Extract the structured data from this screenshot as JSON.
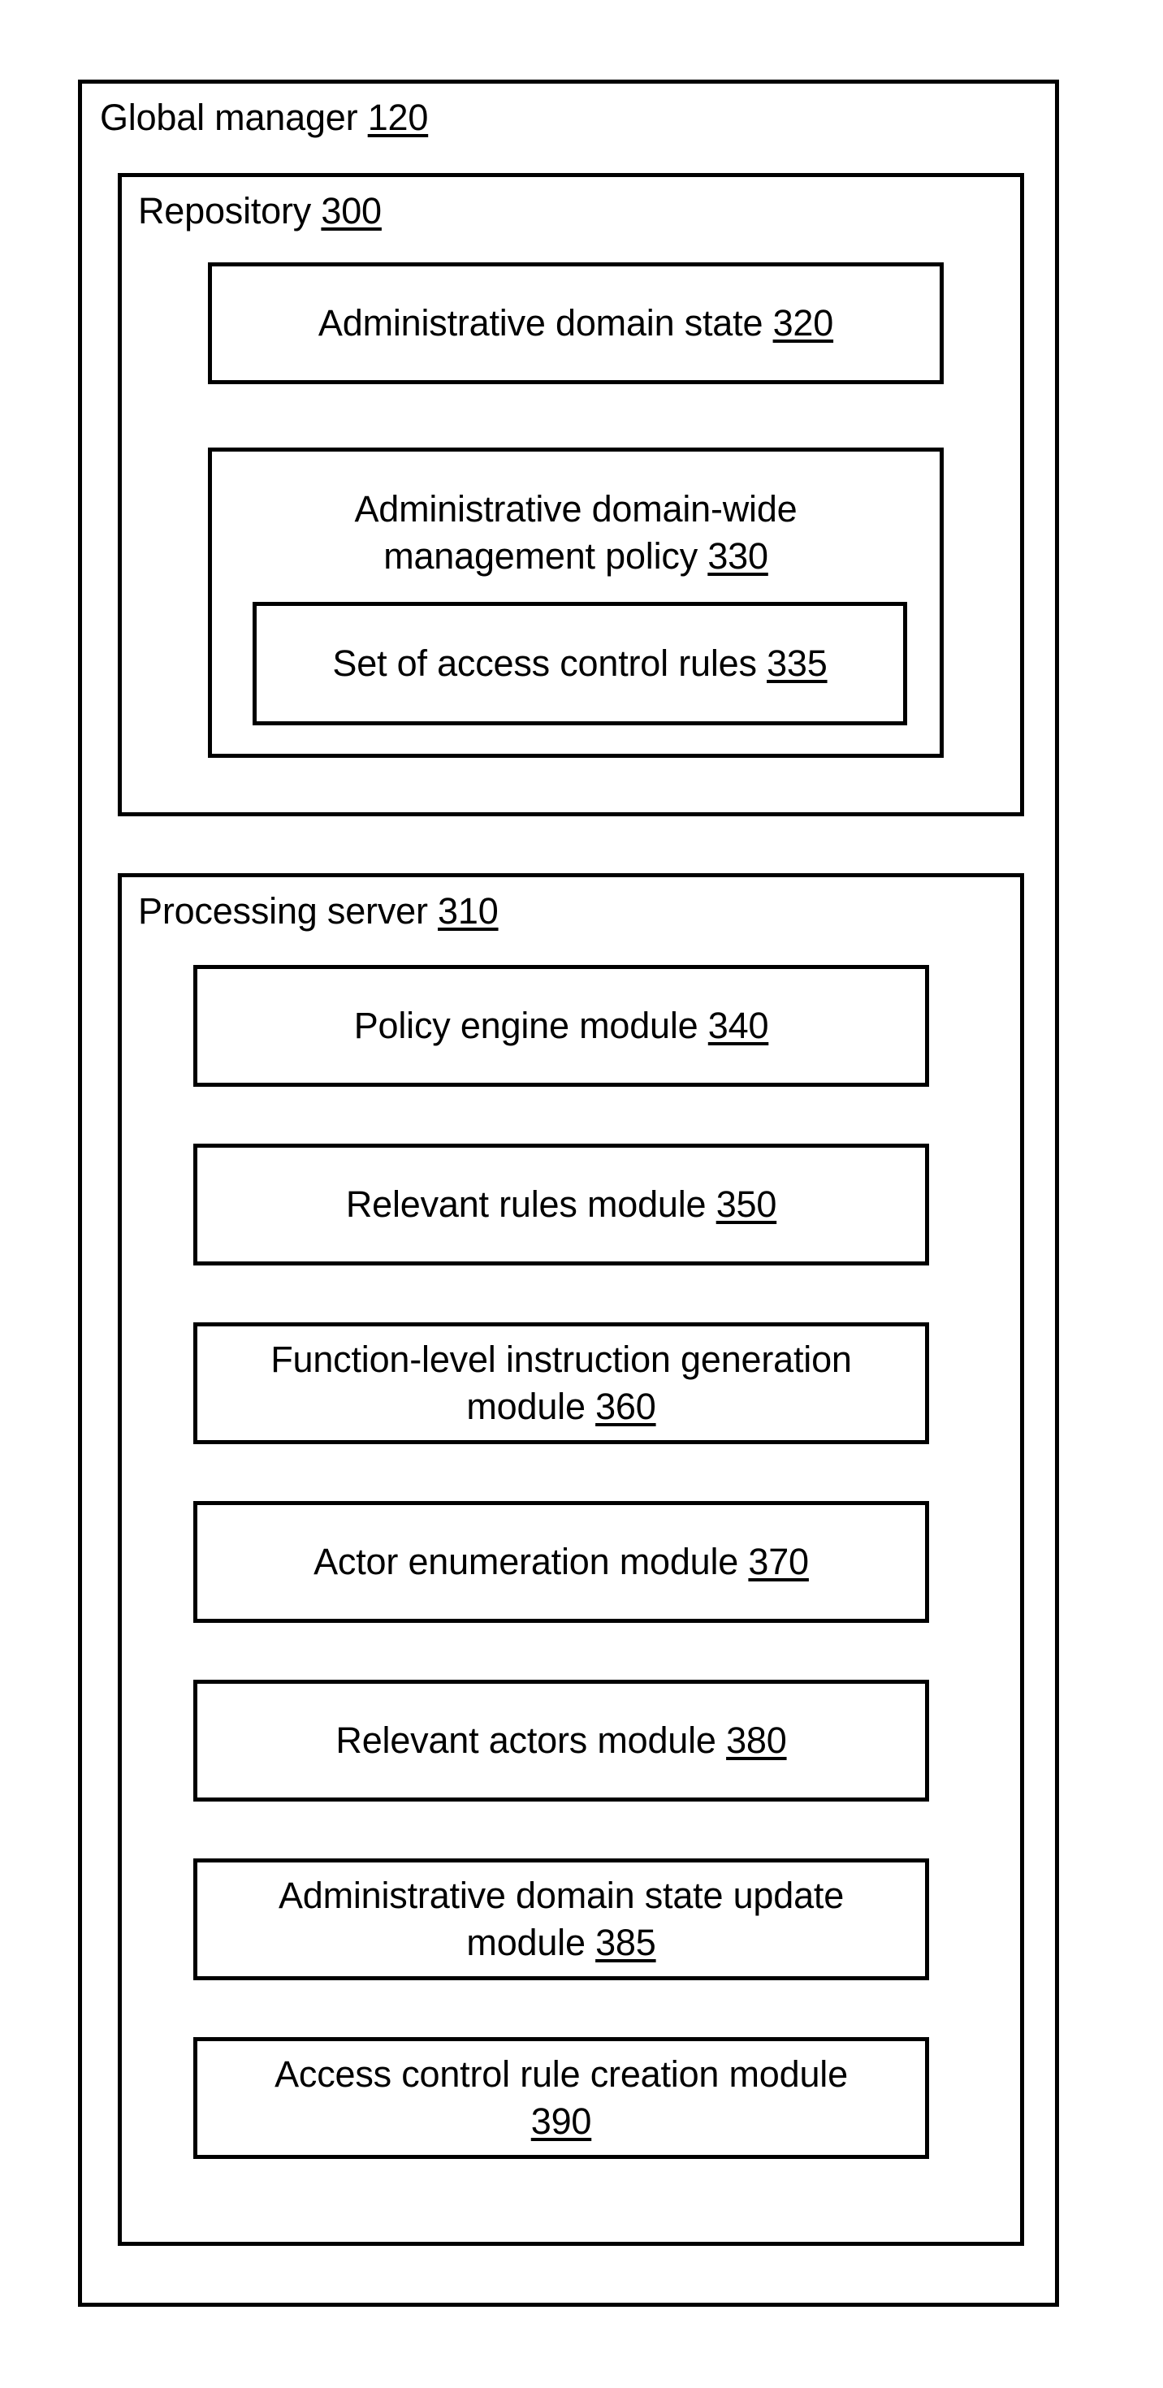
{
  "figure": {
    "type": "block-diagram",
    "title": "Global manager block diagram"
  },
  "global_manager": {
    "label": "Global manager",
    "ref": "120"
  },
  "repository": {
    "label": "Repository",
    "ref": "300",
    "boxes": [
      {
        "name": "administrative-domain-state",
        "label": "Administrative domain state",
        "ref": "320"
      },
      {
        "name": "administrative-domain-wide-management-policy",
        "label": "Administrative domain-wide management policy",
        "line1": "Administrative domain-wide",
        "line2": "management policy",
        "ref": "330",
        "children": [
          {
            "name": "set-of-access-control-rules",
            "label": "Set of access control rules",
            "ref": "335"
          }
        ]
      }
    ]
  },
  "processing_server": {
    "label": "Processing server",
    "ref": "310",
    "modules": [
      {
        "name": "policy-engine-module",
        "label": "Policy engine module",
        "ref": "340"
      },
      {
        "name": "relevant-rules-module",
        "label": "Relevant rules module",
        "ref": "350"
      },
      {
        "name": "function-level-instruction-generation-module",
        "label": "Function-level instruction generation module",
        "line1": "Function-level instruction generation",
        "line2": "module",
        "ref": "360"
      },
      {
        "name": "actor-enumeration-module",
        "label": "Actor enumeration module",
        "ref": "370"
      },
      {
        "name": "relevant-actors-module",
        "label": "Relevant actors module",
        "ref": "380"
      },
      {
        "name": "administrative-domain-state-update-module",
        "label": "Administrative domain state update module",
        "line1": "Administrative domain state update",
        "line2": "module",
        "ref": "385"
      },
      {
        "name": "access-control-rule-creation-module",
        "label": "Access control rule creation module",
        "line1": "Access control rule creation module",
        "line2": "",
        "ref": "390"
      }
    ]
  },
  "colors": {
    "stroke": "#000000",
    "background": "#ffffff",
    "text": "#000000"
  }
}
